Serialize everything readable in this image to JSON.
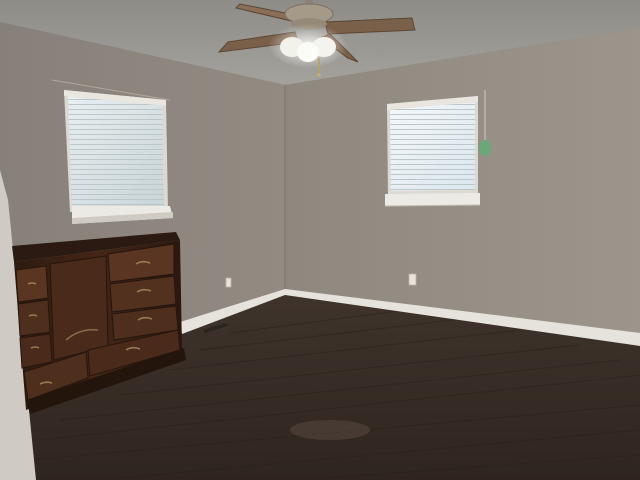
{
  "scene": {
    "subject": "empty-room",
    "colors": {
      "ceiling": "#9a9893",
      "wall_left": "#8c857d",
      "wall_right": "#968f86",
      "floor": "#3a2e27",
      "floor_dark": "#2d231d",
      "baseboard": "#e6e3dc",
      "window_light": "#e8eef0",
      "window_frame": "#dcd9d2",
      "dresser": "#3b2216",
      "dresser_light": "#5a3522",
      "fan_blade": "#7a6048",
      "fan_metal": "#a59a88",
      "fan_light": "#f2f1ea",
      "pull_cord": "#6aa878"
    },
    "objects": [
      "ceiling-fan",
      "left-window",
      "right-window",
      "dresser",
      "floor",
      "baseboard",
      "outlet",
      "floor-vent"
    ]
  }
}
